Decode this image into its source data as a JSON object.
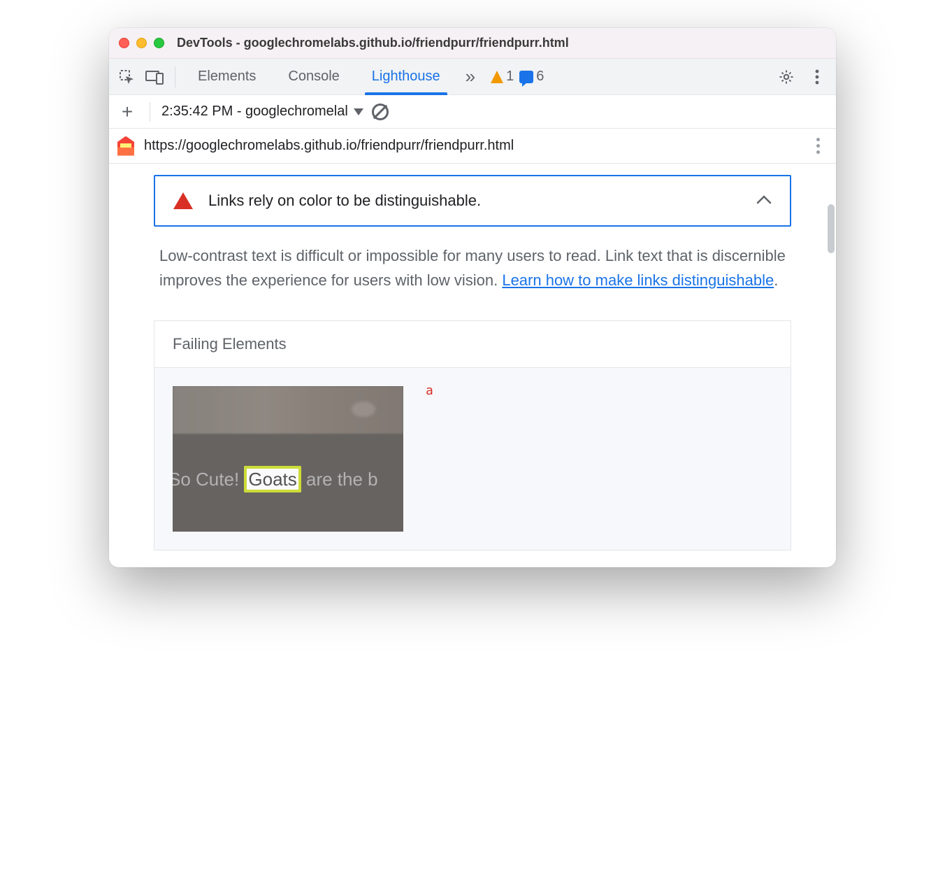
{
  "window": {
    "title": "DevTools - googlechromelabs.github.io/friendpurr/friendpurr.html"
  },
  "tabs": {
    "items": [
      "Elements",
      "Console",
      "Lighthouse"
    ],
    "active_index": 2,
    "more_glyph": "»"
  },
  "counters": {
    "warnings": "1",
    "messages": "6"
  },
  "runbar": {
    "plus": "+",
    "label": "2:35:42 PM - googlechromelal"
  },
  "url": {
    "text": "https://googlechromelabs.github.io/friendpurr/friendpurr.html"
  },
  "audit": {
    "title": "Links rely on color to be distinguishable.",
    "description_pre": "Low-contrast text is difficult or impossible for many users to read. Link text that is discernible improves the experience for users with low vision. ",
    "learn_link": "Learn how to make links distinguishable",
    "description_post": "."
  },
  "failing": {
    "heading": "Failing Elements",
    "tag": "a",
    "thumb_text_pre": "So Cute! ",
    "thumb_text_hl": "Goats",
    "thumb_text_post": " are the b"
  }
}
